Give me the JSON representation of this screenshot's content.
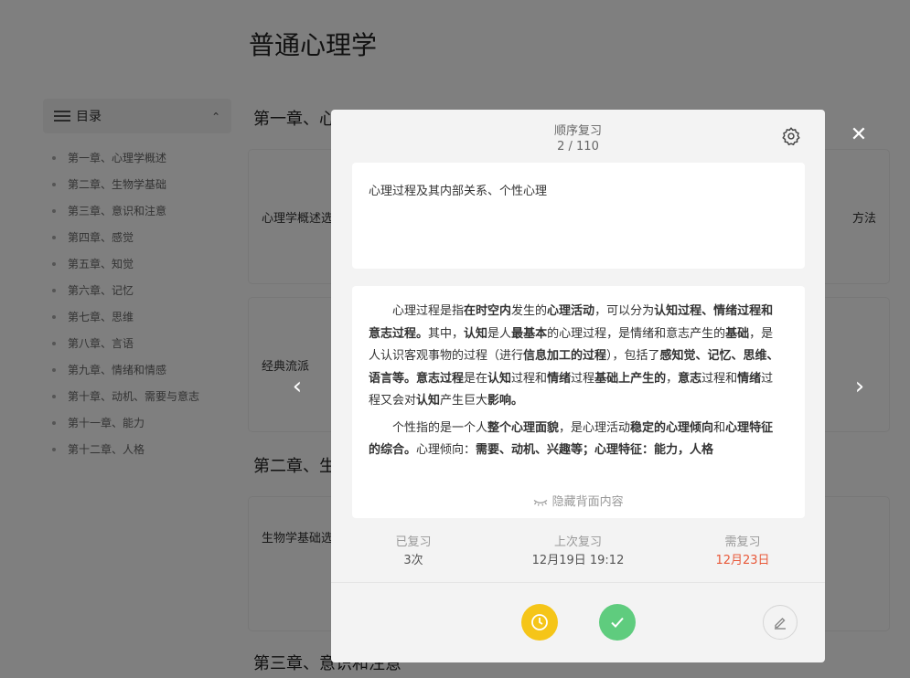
{
  "page": {
    "title": "普通心理学",
    "toc_title": "目录",
    "toc_items": [
      "第一章、心理学概述",
      "第二章、生物学基础",
      "第三章、意识和注意",
      "第四章、感觉",
      "第五章、知觉",
      "第六章、记忆",
      "第七章、思维",
      "第八章、言语",
      "第九章、情绪和情感",
      "第十章、动机、需要与意志",
      "第十一章、能力",
      "第十二章、人格"
    ],
    "sections": [
      "第一章、心",
      "第二章、生",
      "第三章、意识和注意"
    ],
    "cards": [
      {
        "left": "心理学概述选",
        "right": "方法"
      },
      {
        "left": "经典流派",
        "right": ""
      },
      {
        "left": "生物学基础选",
        "right": ""
      }
    ]
  },
  "modal": {
    "mode": "顺序复习",
    "progress": "2 / 110",
    "front": "心理过程及其内部关系、个性心理",
    "back": {
      "p1": [
        {
          "t": "心理过程是指",
          "b": false
        },
        {
          "t": "在时空内",
          "b": true
        },
        {
          "t": "发生的",
          "b": false
        },
        {
          "t": "心理活动",
          "b": true
        },
        {
          "t": "，可以分为",
          "b": false
        },
        {
          "t": "认知过程、情绪过程和意志过程。",
          "b": true
        },
        {
          "t": "其中，",
          "b": false
        },
        {
          "t": "认知",
          "b": true
        },
        {
          "t": "是人",
          "b": false
        },
        {
          "t": "最基本",
          "b": true
        },
        {
          "t": "的心理过程，是情绪和意志产生的",
          "b": false
        },
        {
          "t": "基础",
          "b": true
        },
        {
          "t": "，是人认识客观事物的过程（进行",
          "b": false
        },
        {
          "t": "信息加工的过程",
          "b": true
        },
        {
          "t": "），包括了",
          "b": false
        },
        {
          "t": "感知觉、记忆、思维、语言等。意志过程",
          "b": true
        },
        {
          "t": "是在",
          "b": false
        },
        {
          "t": "认知",
          "b": true
        },
        {
          "t": "过程和",
          "b": false
        },
        {
          "t": "情绪",
          "b": true
        },
        {
          "t": "过程",
          "b": false
        },
        {
          "t": "基础上产生的",
          "b": true
        },
        {
          "t": "，",
          "b": false
        },
        {
          "t": "意志",
          "b": true
        },
        {
          "t": "过程和",
          "b": false
        },
        {
          "t": "情绪",
          "b": true
        },
        {
          "t": "过程又会对",
          "b": false
        },
        {
          "t": "认知",
          "b": true
        },
        {
          "t": "产生巨大",
          "b": false
        },
        {
          "t": "影响。",
          "b": true
        }
      ],
      "p2": [
        {
          "t": "个性指的是一个人",
          "b": false
        },
        {
          "t": "整个心理面貌",
          "b": true
        },
        {
          "t": "，是心理活动",
          "b": false
        },
        {
          "t": "稳定的心理倾向",
          "b": true
        },
        {
          "t": "和",
          "b": false
        },
        {
          "t": "心理特征的综合。",
          "b": true
        },
        {
          "t": "心理倾向：",
          "b": false
        },
        {
          "t": "需要、动机、兴趣等；",
          "b": true
        },
        {
          "t": "心理特征：能力，人格",
          "b": true
        }
      ]
    },
    "hide_back_label": "隐藏背面内容",
    "stats": {
      "reviewed_label": "已复习",
      "reviewed_value": "3次",
      "last_label": "上次复习",
      "last_value": "12月19日 19:12",
      "due_label": "需复习",
      "due_value": "12月23日"
    }
  },
  "colors": {
    "later_button": "#f5c518",
    "know_button": "#5fcc7e",
    "due_date": "#e8593a"
  },
  "icons": {
    "settings": "gear-icon",
    "close": "close-icon",
    "prev": "chevron-left-icon",
    "next": "chevron-right-icon",
    "hide": "eye-closed-icon",
    "later": "clock-icon",
    "know": "check-icon",
    "edit": "pencil-icon"
  }
}
